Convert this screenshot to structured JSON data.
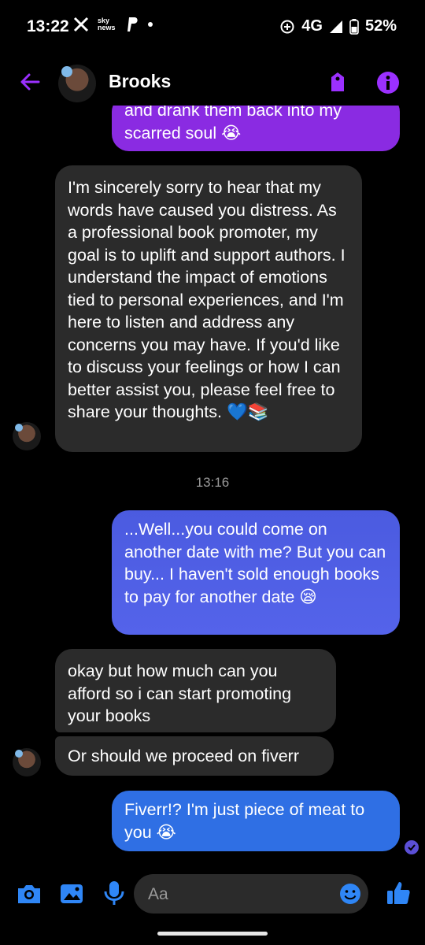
{
  "status_bar": {
    "time": "13:22",
    "news_label": "sky news",
    "network": "4G",
    "battery": "52%"
  },
  "header": {
    "contact_name": "Brooks",
    "accent_color": "#9b30ff"
  },
  "messages": {
    "partial_sent": "and drank them back into my scarred soul 😭",
    "received_1": "I'm sincerely sorry to hear that my words have caused you distress. As a professional book promoter, my goal is to uplift and support authors. I understand the impact of emotions tied to personal experiences, and I'm here to listen and address any concerns you may have. If you'd like to discuss your feelings or how I can better assist you, please feel free to share your thoughts. 💙📚",
    "timestamp": "13:16",
    "sent_2": "...Well...you could come on another date with me? But you can buy... I haven't sold enough books to pay for another date 😪",
    "received_2": "okay but how much can you afford so i can start promoting your books",
    "received_3": "Or should we proceed on fiverr",
    "sent_3": "Fiverr!? I'm just piece of meat to you 😭"
  },
  "composer": {
    "placeholder": "Aa"
  },
  "icons": {
    "back": "back-arrow-icon",
    "tag": "tag-icon",
    "info": "info-icon",
    "camera": "camera-icon",
    "gallery": "image-icon",
    "mic": "microphone-icon",
    "emoji": "emoji-icon",
    "like": "thumbs-up-icon"
  }
}
